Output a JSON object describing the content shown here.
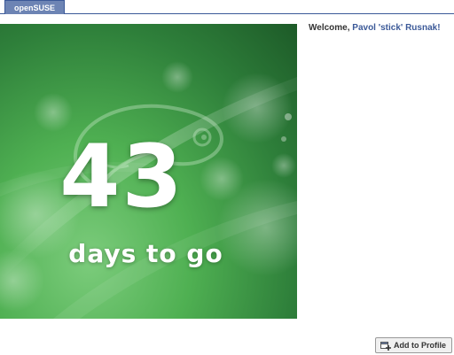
{
  "tabs": [
    {
      "label": "openSUSE"
    }
  ],
  "banner": {
    "days_number": "43",
    "days_text": "days to go",
    "colors": {
      "base": "#4fb052",
      "dark": "#1d5a28",
      "light": "#7ccc7c"
    }
  },
  "welcome": {
    "prefix": "Welcome, ",
    "user_name": "Pavol 'stick' Rusnak!"
  },
  "actions": {
    "add_to_profile": "Add to Profile",
    "add_icon": "add-to-profile-icon"
  },
  "colors": {
    "accent": "#3b5998",
    "tab_bg": "#6d84b4"
  }
}
